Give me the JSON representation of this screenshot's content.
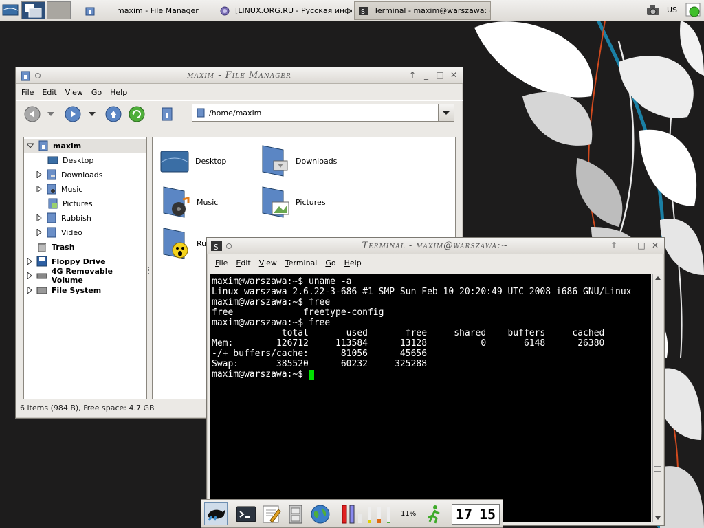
{
  "top_panel": {
    "tasks": [
      {
        "label": "maxim - File Manager",
        "icon": "folder-home-icon"
      },
      {
        "label": "[LINUX.ORG.RU - Русская инфо...",
        "icon": "browser-icon"
      },
      {
        "label": "Terminal - maxim@warszawa: ~",
        "icon": "terminal-icon"
      }
    ],
    "keyboard_layout": "US"
  },
  "file_manager": {
    "title": "maxim - File Manager",
    "menu": [
      {
        "label": "File",
        "underline": "F"
      },
      {
        "label": "Edit",
        "underline": "E"
      },
      {
        "label": "View",
        "underline": "V"
      },
      {
        "label": "Go",
        "underline": "G"
      },
      {
        "label": "Help",
        "underline": "H"
      }
    ],
    "path": "/home/maxim",
    "tree": [
      {
        "label": "maxim",
        "level": 0,
        "bold": true,
        "expanded": true,
        "icon": "home-folder-icon"
      },
      {
        "label": "Desktop",
        "level": 1,
        "icon": "desktop-folder-icon"
      },
      {
        "label": "Downloads",
        "level": 1,
        "expandable": true,
        "icon": "downloads-folder-icon"
      },
      {
        "label": "Music",
        "level": 1,
        "expandable": true,
        "icon": "music-folder-icon"
      },
      {
        "label": "Pictures",
        "level": 1,
        "icon": "pictures-folder-icon"
      },
      {
        "label": "Rubbish",
        "level": 1,
        "expandable": true,
        "icon": "rubbish-folder-icon"
      },
      {
        "label": "Video",
        "level": 1,
        "expandable": true,
        "icon": "video-folder-icon"
      },
      {
        "label": "Trash",
        "level": 0,
        "bold": true,
        "icon": "trash-icon"
      },
      {
        "label": "Floppy Drive",
        "level": 0,
        "bold": true,
        "expandable": true,
        "icon": "floppy-icon"
      },
      {
        "label": "4G Removable Volume",
        "level": 0,
        "bold": true,
        "expandable": true,
        "icon": "removable-drive-icon"
      },
      {
        "label": "File System",
        "level": 0,
        "bold": true,
        "expandable": true,
        "icon": "harddisk-icon"
      }
    ],
    "items": [
      {
        "label": "Desktop",
        "icon": "desktop-folder-icon"
      },
      {
        "label": "Downloads",
        "icon": "downloads-folder-icon"
      },
      {
        "label": "Music",
        "icon": "music-folder-icon"
      },
      {
        "label": "Pictures",
        "icon": "pictures-folder-icon"
      },
      {
        "label": "Ru",
        "icon": "rubbish-folder-icon"
      }
    ],
    "status": "6 items (984 B), Free space: 4.7 GB"
  },
  "terminal": {
    "title": "Terminal - maxim@warszawa:~",
    "menu": [
      {
        "label": "File",
        "underline": "F"
      },
      {
        "label": "Edit",
        "underline": "E"
      },
      {
        "label": "View",
        "underline": "V"
      },
      {
        "label": "Terminal",
        "underline": "T"
      },
      {
        "label": "Go",
        "underline": "G"
      },
      {
        "label": "Help",
        "underline": "H"
      }
    ],
    "lines": [
      "maxim@warszawa:~$ uname -a",
      "Linux warszawa 2.6.22-3-686 #1 SMP Sun Feb 10 20:20:49 UTC 2008 i686 GNU/Linux",
      "maxim@warszawa:~$ free",
      "free             freetype-config",
      "maxim@warszawa:~$ free",
      "             total       used       free     shared    buffers     cached",
      "Mem:        126712     113584      13128          0       6148      26380",
      "-/+ buffers/cache:      81056      45656",
      "Swap:       385520      60232     325288"
    ],
    "prompt": "maxim@warszawa:~$ "
  },
  "dock": {
    "cpu_percent": "11%",
    "clock_hour": "17",
    "clock_minute": "15"
  },
  "colors": {
    "terminal_bg": "#000000",
    "terminal_fg": "#ffffff",
    "cursor": "#00e000",
    "accent_blue": "#3a6ea5"
  }
}
